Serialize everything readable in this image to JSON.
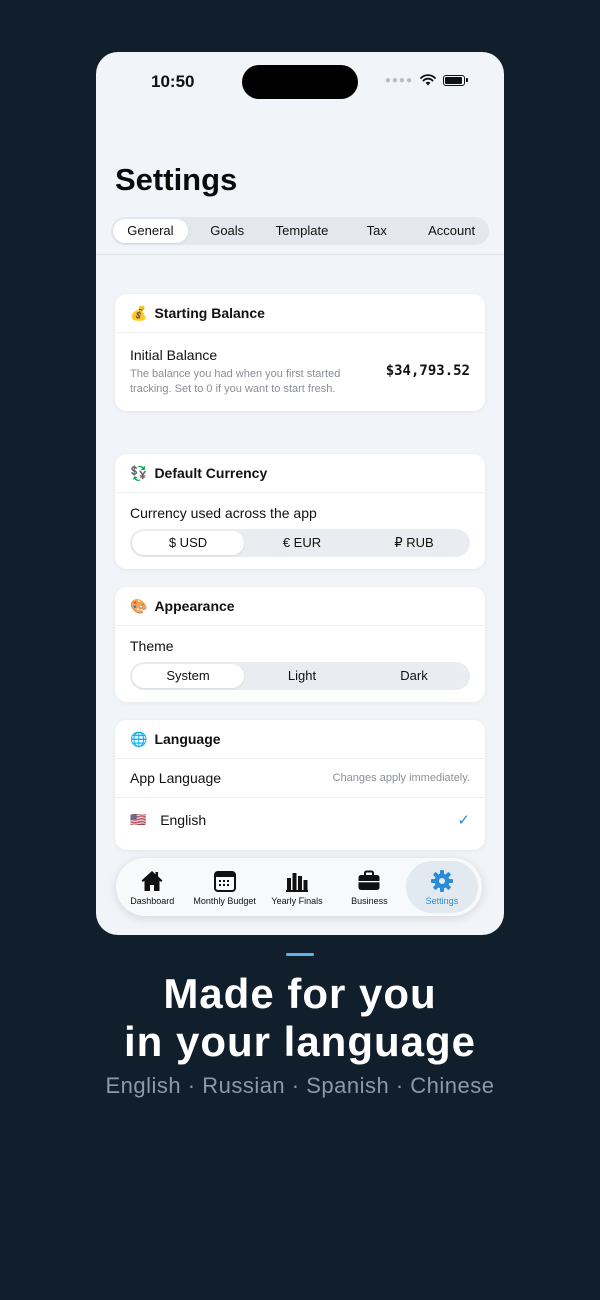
{
  "status": {
    "time": "10:50"
  },
  "title": "Settings",
  "tabs": [
    "General",
    "Goals",
    "Template",
    "Tax",
    "Account"
  ],
  "starting_balance": {
    "emoji": "💰",
    "title": "Starting Balance",
    "label": "Initial Balance",
    "description": "The balance you had when you first started tracking. Set to 0 if you want to start fresh.",
    "value": "$34,793.52"
  },
  "currency": {
    "emoji": "💱",
    "title": "Default Currency",
    "label": "Currency used across the app",
    "options": [
      "$ USD",
      "€ EUR",
      "₽ RUB"
    ],
    "selected": "$ USD"
  },
  "appearance": {
    "emoji": "🎨",
    "title": "Appearance",
    "label": "Theme",
    "options": [
      "System",
      "Light",
      "Dark"
    ],
    "selected": "System"
  },
  "language": {
    "emoji": "🌐",
    "title": "Language",
    "label": "App Language",
    "note": "Changes apply immediately.",
    "items": [
      {
        "flag": "🇺🇸",
        "name": "English",
        "selected": true
      }
    ]
  },
  "tabbar": [
    "Dashboard",
    "Monthly Budget",
    "Yearly Finals",
    "Business",
    "Settings"
  ],
  "promo": {
    "line1": "Made for you",
    "line2": "in your language",
    "subtitle": "English · Russian · Spanish · Chinese"
  },
  "colors": {
    "accent": "#2a8cd6",
    "background": "#111e2c",
    "screen": "#f1f4f8"
  }
}
